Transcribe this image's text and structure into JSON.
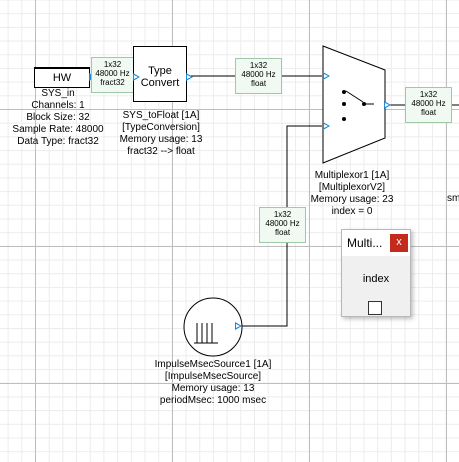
{
  "sys_in": {
    "block_text": "HW",
    "label_lines": [
      "SYS_in",
      "Channels: 1",
      "Block Size: 32",
      "Sample Rate: 48000",
      "Data Type: fract32"
    ]
  },
  "tags": {
    "sys_in_out": [
      "1x32",
      "48000 Hz",
      "fract32"
    ],
    "convert_out": [
      "1x32",
      "48000 Hz",
      "float"
    ],
    "mux_out": [
      "1x32",
      "48000 Hz",
      "float"
    ],
    "source_out": [
      "1x32",
      "48000 Hz",
      "float"
    ]
  },
  "type_convert": {
    "block_text": [
      "Type",
      "Convert"
    ],
    "label_lines": [
      "SYS_toFloat [1A]",
      "[TypeConversion]",
      "Memory usage: 13",
      "fract32 --> float"
    ]
  },
  "multiplexor": {
    "label_lines": [
      "Multiplexor1 [1A]",
      "[MultiplexorV2]",
      "Memory usage: 23",
      "index = 0"
    ]
  },
  "impulse_source": {
    "label_lines": [
      "ImpulseMsecSource1 [1A]",
      "[ImpulseMsecSource]",
      "Memory usage: 13",
      "periodMsec: 1000 msec"
    ]
  },
  "popup": {
    "title": "Multi...",
    "close_glyph": "x",
    "field_label": "index"
  },
  "edge_text": "sm"
}
